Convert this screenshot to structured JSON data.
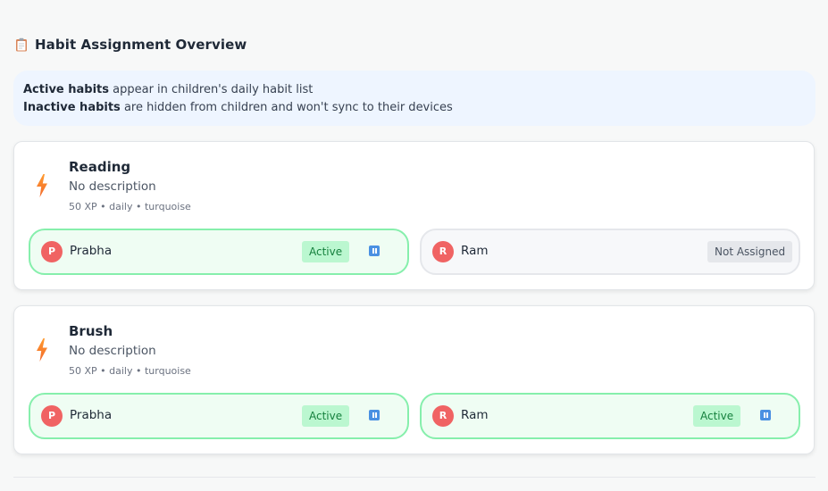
{
  "header": {
    "icon": "clipboard-icon",
    "title": "Habit Assignment Overview"
  },
  "info": {
    "active_bold": "Active habits",
    "active_text": " appear in children's daily habit list",
    "inactive_bold": "Inactive habits",
    "inactive_text": " are hidden from children and won't sync to their devices"
  },
  "habits": [
    {
      "name": "Reading",
      "description": "No description",
      "meta": "50 XP • daily • turquoise",
      "icon": "bolt-icon",
      "assignments": [
        {
          "initial": "P",
          "child": "Prabha",
          "status": "Active",
          "assigned": true,
          "action_icon": "pause-icon"
        },
        {
          "initial": "R",
          "child": "Ram",
          "status": "Not Assigned",
          "assigned": false
        }
      ]
    },
    {
      "name": "Brush",
      "description": "No description",
      "meta": "50 XP • daily • turquoise",
      "icon": "bolt-icon",
      "assignments": [
        {
          "initial": "P",
          "child": "Prabha",
          "status": "Active",
          "assigned": true,
          "action_icon": "pause-icon"
        },
        {
          "initial": "R",
          "child": "Ram",
          "status": "Active",
          "assigned": true,
          "action_icon": "pause-icon"
        }
      ]
    }
  ],
  "colors": {
    "active_border": "#86efac",
    "active_bg": "#effdf3",
    "active_badge": "#bbf7d0",
    "avatar": "#f06363",
    "pause_button": "#4a90e2",
    "info_bg": "#eef5ff"
  }
}
